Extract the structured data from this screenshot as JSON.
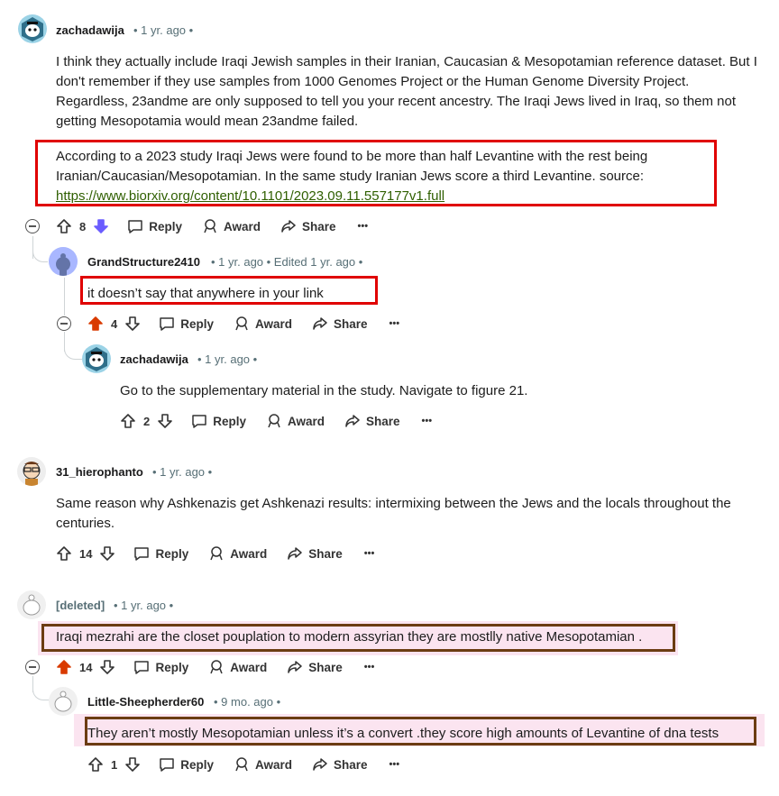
{
  "comments": [
    {
      "username": "zachadawija",
      "meta": "• 1 yr. ago •",
      "body": "I think they actually include Iraqi Jewish samples in their Iranian, Caucasian & Mesopotamian reference dataset. But I don't remember if they use samples from 1000 Genomes Project or the Human Genome Diversity Project. Regardless, 23andme are only supposed to tell you your recent ancestry. The Iraqi Jews lived in Iraq, so them not getting Mesopotamia would mean 23andme failed.",
      "body2": "According to a 2023 study Iraqi Jews were found to be more than half Levantine with the rest being Iranian/Caucasian/Mesopotamian. In the same study Iranian Jews score a third Levantine. source:",
      "link": "https://www.biorxiv.org/content/10.1101/2023.09.11.557177v1.full",
      "votes": "8"
    },
    {
      "username": "GrandStructure2410",
      "meta": "• 1 yr. ago • Edited 1 yr. ago •",
      "body": "it doesn’t say that anywhere in your link",
      "votes": "4"
    },
    {
      "username": "zachadawija",
      "meta": "• 1 yr. ago •",
      "body": "Go to the supplementary material in the study. Navigate to figure 21.",
      "votes": "2"
    },
    {
      "username": "31_hierophanto",
      "meta": "• 1 yr. ago •",
      "body": "Same reason why Ashkenazis get Ashkenazi results: intermixing between the Jews and the locals throughout the centuries.",
      "votes": "14"
    },
    {
      "username": "[deleted]",
      "meta": "• 1 yr. ago •",
      "body": "Iraqi mezrahi are the closet pouplation to modern assyrian they are mostlly native Mesopotamian .",
      "votes": "14"
    },
    {
      "username": "Little-Sheepherder60",
      "meta": "• 9 mo. ago •",
      "body": "They aren’t mostly Mesopotamian unless it’s a convert .they score high amounts of Levantine of dna tests",
      "votes": "1"
    }
  ],
  "actions": {
    "reply": "Reply",
    "award": "Award",
    "share": "Share",
    "more": "•••"
  },
  "colors": {
    "upvote_active": "#d93a00",
    "downvote_active": "#6a5cff",
    "highlight_red": "#e00000",
    "highlight_brown": "#6b3c12",
    "link": "#2f5f00"
  }
}
